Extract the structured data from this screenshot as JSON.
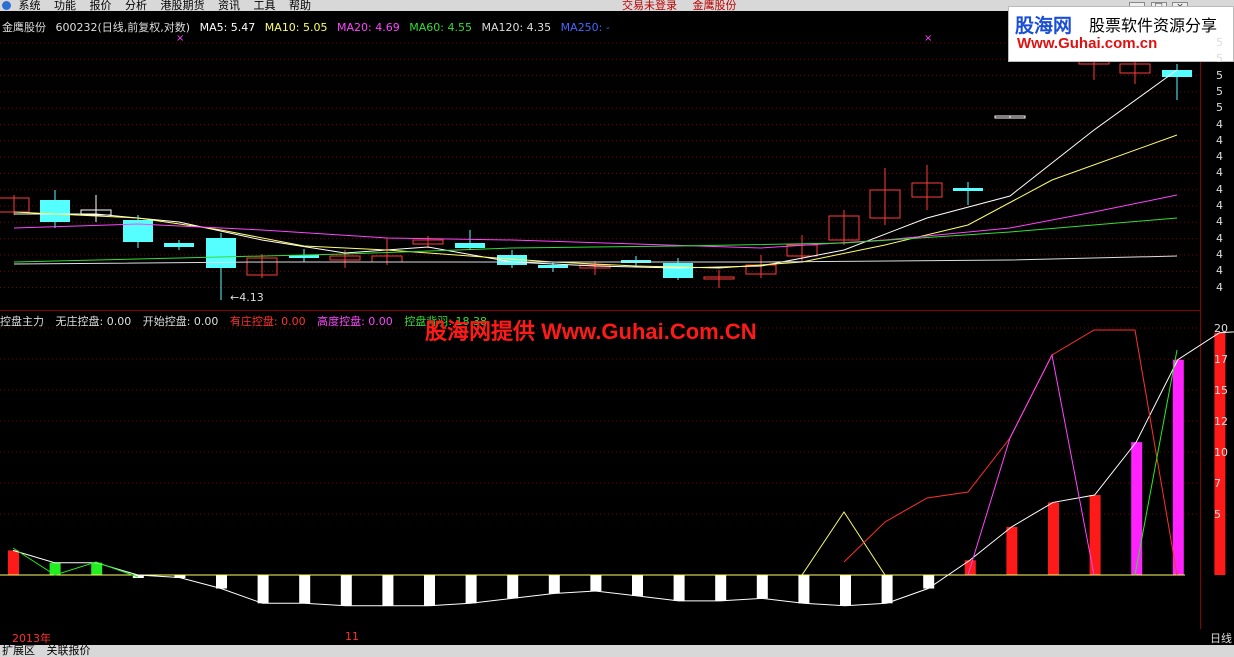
{
  "menu": {
    "items": [
      "系统",
      "功能",
      "报价",
      "分析",
      "港股期货",
      "资讯",
      "工具",
      "帮助"
    ],
    "status1": "交易未登录",
    "status2": "金鹰股份"
  },
  "window_controls": [
    "_",
    "□",
    "×"
  ],
  "logo": {
    "name": "股海网",
    "tagline": "股票软件资源分享",
    "url": "Www.Guhai.com.cn"
  },
  "kline": {
    "header": {
      "stock": "金鹰股份",
      "code_desc": "600232(日线,前复权,对数)",
      "ma5": "MA5: 5.47",
      "ma10": "MA10: 5.05",
      "ma20": "MA20: 4.69",
      "ma60": "MA60: 4.55",
      "ma120": "MA120: 4.35",
      "ma250": "MA250: -"
    },
    "low_label": "4.13",
    "y_ticks": [
      "5",
      "5",
      "5",
      "5",
      "5",
      "4",
      "4",
      "4",
      "4",
      "4",
      "4",
      "4",
      "4",
      "4",
      "4",
      "4"
    ]
  },
  "indicator": {
    "header": {
      "name": "控盘主力",
      "no_control": "无庄控盘: 0.00",
      "start_control": "开始控盘: 0.00",
      "has_control": "有庄控盘: 0.00",
      "high_control": "高度控盘: 0.00",
      "control_exit": "控盘背羽: 18.38"
    },
    "watermark": "股海网提供 Www.Guhai.Com.CN",
    "y_ticks": [
      "20",
      "17",
      "15",
      "12",
      "10",
      "7",
      "5"
    ],
    "bars": [
      2,
      1,
      1,
      0,
      -0.2,
      -1.1,
      -2.3,
      -2.3,
      -2.5,
      -2.5,
      -2.5,
      -2.3,
      -1.9,
      -1.5,
      -1.3,
      -1.7,
      -2.1,
      -2.1,
      -1.9,
      -2.3,
      -2.5,
      -2.3,
      -1.1,
      1.2,
      3.9,
      5.9,
      6.5,
      10.8,
      17.5,
      19.7,
      19.9,
      18.0
    ],
    "colors": [
      "red",
      "green",
      "green",
      "white",
      "white",
      "white",
      "white",
      "white",
      "white",
      "white",
      "white",
      "white",
      "white",
      "white",
      "white",
      "white",
      "white",
      "white",
      "white",
      "white",
      "white",
      "white",
      "white",
      "red",
      "red",
      "red",
      "red",
      "magenta",
      "magenta",
      "red",
      "red",
      "green"
    ]
  },
  "axis_bottom": {
    "d1": "2013年",
    "d2": "11",
    "period": "日线"
  },
  "tabs": [
    "扩展区",
    "关联报价"
  ],
  "colors": {
    "up": "#ff3b3b",
    "down": "#55ffff",
    "ma5": "#ffffff",
    "ma10": "#ffff66",
    "ma20": "#ff44ff",
    "ma60": "#33dd33",
    "ma120": "#dddddd"
  }
}
